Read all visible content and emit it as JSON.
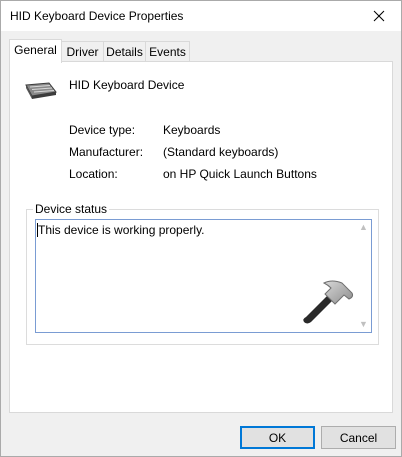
{
  "window": {
    "title": "HID Keyboard Device Properties"
  },
  "tabs": [
    {
      "label": "General",
      "active": true
    },
    {
      "label": "Driver",
      "active": false
    },
    {
      "label": "Details",
      "active": false
    },
    {
      "label": "Events",
      "active": false
    }
  ],
  "device": {
    "name": "HID Keyboard Device",
    "icon": "keyboard-icon",
    "properties": [
      {
        "label": "Device type:",
        "value": "Keyboards"
      },
      {
        "label": "Manufacturer:",
        "value": "(Standard keyboards)"
      },
      {
        "label": "Location:",
        "value": "on HP Quick Launch Buttons"
      }
    ]
  },
  "status": {
    "legend": "Device status",
    "text": "This device is working properly."
  },
  "buttons": {
    "ok": "OK",
    "cancel": "Cancel"
  },
  "colors": {
    "focus_border": "#0078d7",
    "textbox_border": "#7a9cd3",
    "dialog_bg": "#f0f0f0"
  }
}
